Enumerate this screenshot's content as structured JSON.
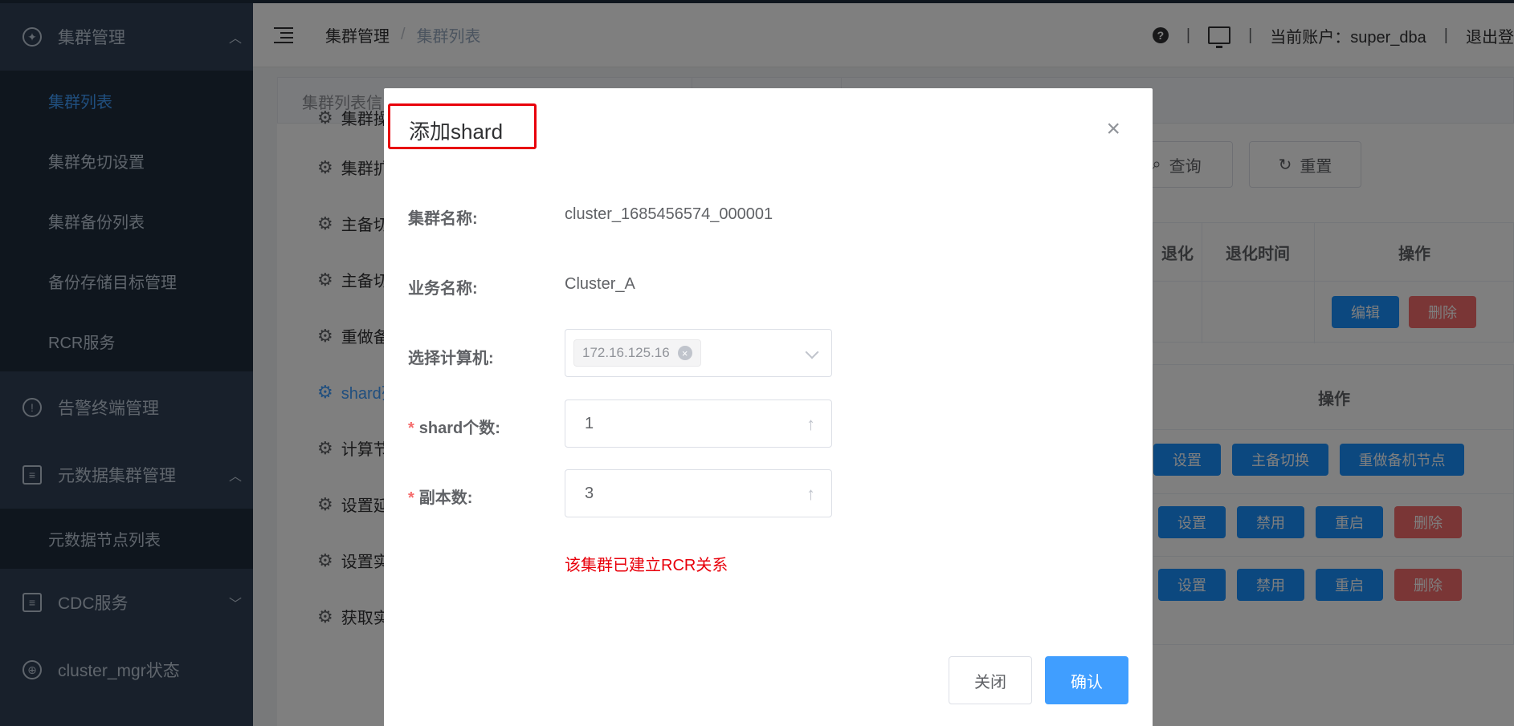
{
  "sidebar": {
    "groups": [
      {
        "label": "集群管理",
        "icon": "cluster-icon",
        "expanded": true
      },
      {
        "label": "告警终端管理",
        "icon": "alert-icon",
        "expanded": false
      },
      {
        "label": "元数据集群管理",
        "icon": "metadata-icon",
        "expanded": true
      },
      {
        "label": "CDC服务",
        "icon": "cdc-icon",
        "expanded": false
      },
      {
        "label": "cluster_mgr状态",
        "icon": "status-icon",
        "expanded": false
      }
    ],
    "cluster_items": [
      "集群列表",
      "集群免切设置",
      "集群备份列表",
      "备份存储目标管理",
      "RCR服务"
    ],
    "metadata_items": [
      "元数据节点列表"
    ]
  },
  "header": {
    "breadcrumb": [
      "集群管理",
      "集群列表"
    ],
    "account_label": "当前账户：super_dba",
    "logout": "退出登"
  },
  "main": {
    "tabs": [
      "集群列表信"
    ],
    "side_actions": [
      "集群操",
      "集群扩",
      "主备切",
      "主备切",
      "重做备",
      "shard列",
      "计算节",
      "设置延",
      "设置实",
      "获取实"
    ],
    "query_button": "查询",
    "reset_button": "重置",
    "table1_headers": [
      "退化",
      "退化时间",
      "操作"
    ],
    "table1_row": {
      "edit": "编辑",
      "delete": "删除"
    },
    "table2_header": "操作",
    "table2_rows": [
      [
        "设置",
        "主备切换",
        "重做备机节点"
      ],
      [
        "设置",
        "禁用",
        "重启",
        "删除"
      ],
      [
        "设置",
        "禁用",
        "重启",
        "删除"
      ]
    ]
  },
  "dialog": {
    "title": "添加shard",
    "close_icon": "×",
    "cluster_name_label": "集群名称:",
    "cluster_name_value": "cluster_1685456574_000001",
    "business_name_label": "业务名称:",
    "business_name_value": "Cluster_A",
    "machine_label": "选择计算机:",
    "machine_tag": "172.16.125.16",
    "shard_count_label": "shard个数:",
    "shard_count_value": "1",
    "replica_label": "副本数:",
    "replica_value": "3",
    "required_mark": "*",
    "warning": "该集群已建立RCR关系",
    "cancel_button": "关闭",
    "confirm_button": "确认"
  },
  "colors": {
    "sidebar_bg": "#304156",
    "sidebar_sub_bg": "#1f2d3d",
    "accent": "#409eff",
    "danger": "#f56c6c",
    "highlight": "#e8000b"
  }
}
